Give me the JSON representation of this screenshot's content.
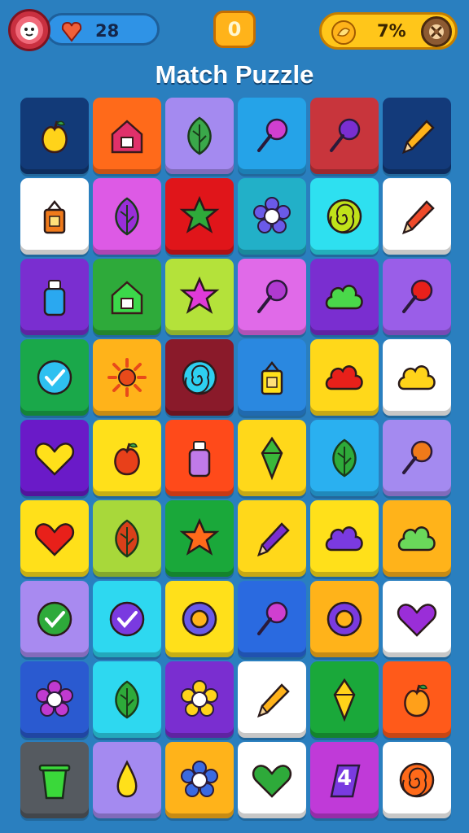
{
  "header": {
    "lives_value": "28",
    "level_value": "0",
    "coins_value": "7%",
    "title": "Match Puzzle",
    "icons": {
      "avatar": "lion-avatar-icon",
      "lives": "heart-gem-icon",
      "coins": "gold-coin-icon",
      "settings": "gear-icon"
    }
  },
  "board": {
    "rows": 9,
    "cols": 6,
    "tiles": [
      [
        {
          "bg": "#123a78",
          "icon": "apple",
          "fg": "#ffd31a"
        },
        {
          "bg": "#ff6a1a",
          "icon": "house",
          "fg": "#e0306a"
        },
        {
          "bg": "#a48af0",
          "icon": "leaf",
          "fg": "#3aa84a"
        },
        {
          "bg": "#25a3e8",
          "icon": "lollipop",
          "fg": "#d03fd0"
        },
        {
          "bg": "#c8353c",
          "icon": "lollipop",
          "fg": "#7a2ed0"
        },
        {
          "bg": "#133a7a",
          "icon": "pencil",
          "fg": "#ffb31a"
        }
      ],
      [
        {
          "bg": "#ffffff",
          "icon": "lantern",
          "fg": "#f07a1a"
        },
        {
          "bg": "#dd5ae5",
          "icon": "leaf",
          "fg": "#9a2ed8"
        },
        {
          "bg": "#e0151a",
          "icon": "star",
          "fg": "#2eaa3a"
        },
        {
          "bg": "#22b0c8",
          "icon": "flower",
          "fg": "#6a5ae8"
        },
        {
          "bg": "#2ee0f0",
          "icon": "spiral",
          "fg": "#c0e21a"
        },
        {
          "bg": "#ffffff",
          "icon": "pencil",
          "fg": "#ee4a2a"
        }
      ],
      [
        {
          "bg": "#7a2ed0",
          "icon": "bottle",
          "fg": "#2aa8f0"
        },
        {
          "bg": "#2eaa3a",
          "icon": "house",
          "fg": "#3bd84a"
        },
        {
          "bg": "#b4e23a",
          "icon": "star",
          "fg": "#e03ad8"
        },
        {
          "bg": "#e06ae8",
          "icon": "lollipop",
          "fg": "#b03ad0"
        },
        {
          "bg": "#7a2ed0",
          "icon": "cloud",
          "fg": "#4ad84a"
        },
        {
          "bg": "#9a5ee8",
          "icon": "lollipop",
          "fg": "#e8201a"
        }
      ],
      [
        {
          "bg": "#1aa84a",
          "icon": "check",
          "fg": "#2ec0f0"
        },
        {
          "bg": "#ffb31a",
          "icon": "sun",
          "fg": "#e84a1a"
        },
        {
          "bg": "#8a1a2a",
          "icon": "spiral",
          "fg": "#2ed0f0"
        },
        {
          "bg": "#2a88e0",
          "icon": "lantern",
          "fg": "#ffe01a"
        },
        {
          "bg": "#ffd81a",
          "icon": "cloud",
          "fg": "#e8201a"
        },
        {
          "bg": "#ffffff",
          "icon": "cloud",
          "fg": "#ffd31a"
        }
      ],
      [
        {
          "bg": "#6a1ac8",
          "icon": "heart",
          "fg": "#ffe01a"
        },
        {
          "bg": "#ffe01a",
          "icon": "apple",
          "fg": "#e8401a"
        },
        {
          "bg": "#ff4a1a",
          "icon": "bottle",
          "fg": "#c07ae8"
        },
        {
          "bg": "#ffd81a",
          "icon": "gem",
          "fg": "#3ab83a"
        },
        {
          "bg": "#2ab0f0",
          "icon": "leaf",
          "fg": "#2eaa3a"
        },
        {
          "bg": "#a48af0",
          "icon": "lollipop",
          "fg": "#f07a1a"
        }
      ],
      [
        {
          "bg": "#ffe01a",
          "icon": "heart",
          "fg": "#e8201a"
        },
        {
          "bg": "#a8d83a",
          "icon": "leaf",
          "fg": "#d8401a"
        },
        {
          "bg": "#1aa83a",
          "icon": "star",
          "fg": "#ff6a1a"
        },
        {
          "bg": "#ffd81a",
          "icon": "pencil",
          "fg": "#7a2ed0"
        },
        {
          "bg": "#ffe01a",
          "icon": "cloud",
          "fg": "#7a3ae0"
        },
        {
          "bg": "#ffb31a",
          "icon": "cloud",
          "fg": "#6ad85a"
        }
      ],
      [
        {
          "bg": "#a88af0",
          "icon": "check",
          "fg": "#2eaa3a"
        },
        {
          "bg": "#2ed8f0",
          "icon": "check",
          "fg": "#7a3ae0"
        },
        {
          "bg": "#ffe01a",
          "icon": "ring",
          "fg": "#6a5ae8"
        },
        {
          "bg": "#2a6ae0",
          "icon": "lollipop",
          "fg": "#d03fd0"
        },
        {
          "bg": "#ffb31a",
          "icon": "ring",
          "fg": "#7a3ae0"
        },
        {
          "bg": "#ffffff",
          "icon": "heart",
          "fg": "#9a2ed8"
        }
      ],
      [
        {
          "bg": "#2a5ad0",
          "icon": "flower",
          "fg": "#c03ad0"
        },
        {
          "bg": "#2ed8f0",
          "icon": "leaf",
          "fg": "#2eaa3a"
        },
        {
          "bg": "#7a2ed0",
          "icon": "flower",
          "fg": "#ffd31a"
        },
        {
          "bg": "#ffffff",
          "icon": "pencil",
          "fg": "#ffb31a"
        },
        {
          "bg": "#1aa83a",
          "icon": "gem",
          "fg": "#ffd31a"
        },
        {
          "bg": "#ff5a1a",
          "icon": "apple",
          "fg": "#ffa01a"
        }
      ],
      [
        {
          "bg": "#555a60",
          "icon": "bin",
          "fg": "#3ad83a"
        },
        {
          "bg": "#a48af0",
          "icon": "drop",
          "fg": "#ffe01a"
        },
        {
          "bg": "#ffb31a",
          "icon": "flower",
          "fg": "#3a6ae0"
        },
        {
          "bg": "#ffffff",
          "icon": "heart",
          "fg": "#2eaa3a"
        },
        {
          "bg": "#c03ad8",
          "icon": "number",
          "fg": "#7a3ae0",
          "label": "4"
        },
        {
          "bg": "#ffffff",
          "icon": "spiral",
          "fg": "#ff6a1a"
        }
      ]
    ]
  }
}
